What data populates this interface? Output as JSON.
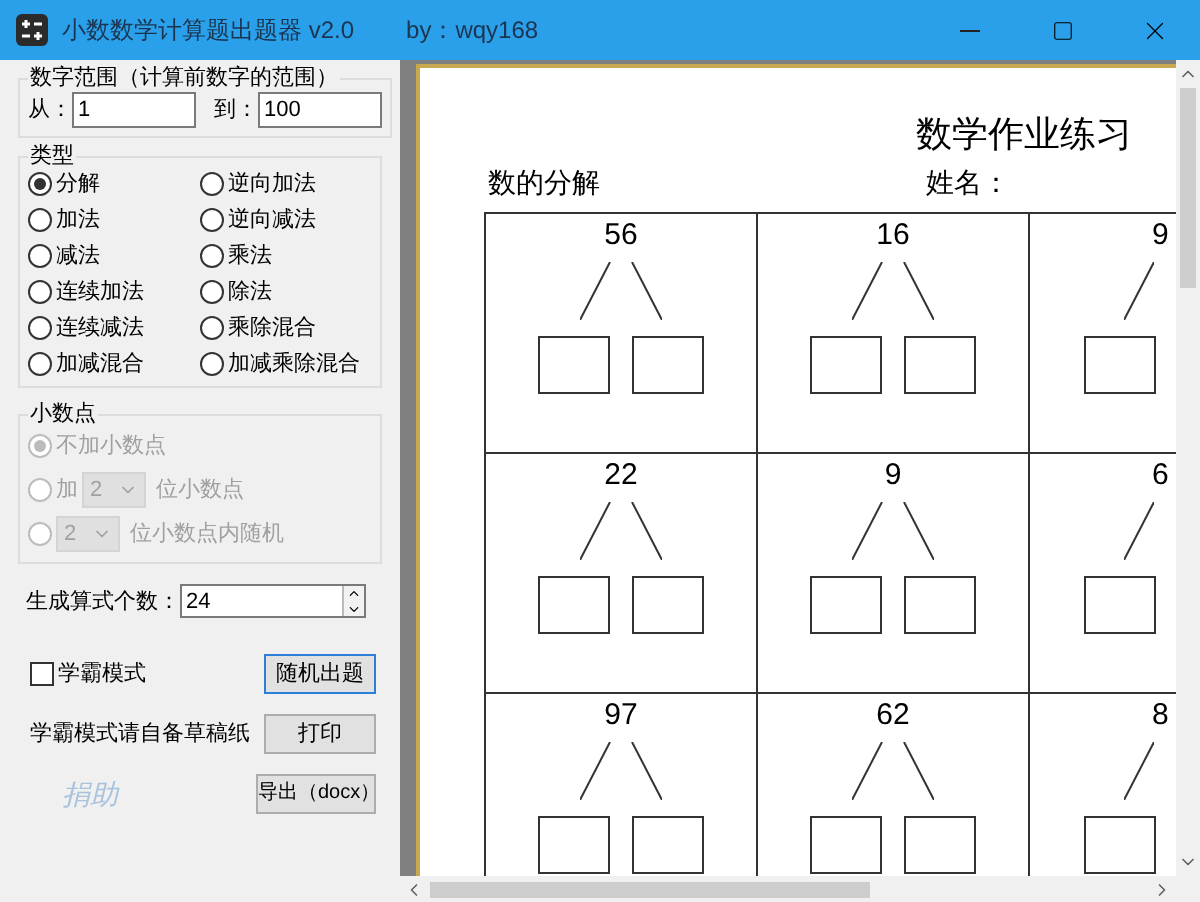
{
  "window": {
    "title": "小数数学计算题出题器 v2.0",
    "author": "by：wqy168"
  },
  "range": {
    "legend": "数字范围（计算前数字的范围）",
    "from_label": "从：",
    "from_value": "1",
    "to_label": "到：",
    "to_value": "100"
  },
  "type_group": {
    "legend": "类型",
    "options": [
      {
        "label": "分解",
        "selected": true
      },
      {
        "label": "逆向加法",
        "selected": false
      },
      {
        "label": "加法",
        "selected": false
      },
      {
        "label": "逆向减法",
        "selected": false
      },
      {
        "label": "减法",
        "selected": false
      },
      {
        "label": "乘法",
        "selected": false
      },
      {
        "label": "连续加法",
        "selected": false
      },
      {
        "label": "除法",
        "selected": false
      },
      {
        "label": "连续减法",
        "selected": false
      },
      {
        "label": "乘除混合",
        "selected": false
      },
      {
        "label": "加减混合",
        "selected": false
      },
      {
        "label": "加减乘除混合",
        "selected": false
      }
    ]
  },
  "decimal_group": {
    "legend": "小数点",
    "disabled": true,
    "options": [
      {
        "kind": "plain",
        "label": "不加小数点",
        "selected": true
      },
      {
        "kind": "fixed",
        "prefix": "加",
        "select_value": "2",
        "suffix": "位小数点",
        "selected": false
      },
      {
        "kind": "random",
        "select_value": "2",
        "suffix": "位小数点内随机",
        "selected": false
      }
    ]
  },
  "count": {
    "label": "生成算式个数：",
    "value": "24"
  },
  "mode_checkbox": {
    "label": "学霸模式",
    "checked": false
  },
  "note": "学霸模式请自备草稿纸",
  "donate_link": "捐助",
  "buttons": [
    {
      "label": "随机出题",
      "focused": true
    },
    {
      "label": "打印",
      "focused": false
    },
    {
      "label": "导出（docx）",
      "focused": false
    }
  ],
  "preview": {
    "title": "数学作业练习",
    "subtitle": "数的分解",
    "name_label": "姓名：",
    "rows": [
      [
        {
          "kind": "full",
          "number": "56"
        },
        {
          "kind": "full",
          "number": "16"
        },
        {
          "kind": "cut",
          "number": "9"
        }
      ],
      [
        {
          "kind": "full",
          "number": "22"
        },
        {
          "kind": "full",
          "number": "9"
        },
        {
          "kind": "cut",
          "number": "6"
        }
      ],
      [
        {
          "kind": "full",
          "number": "97"
        },
        {
          "kind": "full",
          "number": "62"
        },
        {
          "kind": "cut",
          "number": "8"
        }
      ]
    ]
  }
}
